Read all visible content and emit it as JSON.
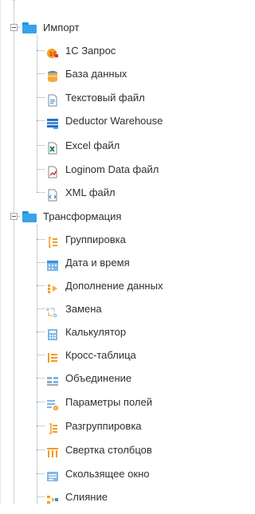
{
  "groups": [
    {
      "label": "Импорт",
      "items": [
        {
          "label": "1C Запрос",
          "icon": "1c-query-icon"
        },
        {
          "label": "База данных",
          "icon": "database-icon"
        },
        {
          "label": "Текстовый файл",
          "icon": "text-file-icon"
        },
        {
          "label": "Deductor Warehouse",
          "icon": "warehouse-icon"
        },
        {
          "label": "Excel файл",
          "icon": "excel-file-icon"
        },
        {
          "label": "Loginom Data файл",
          "icon": "loginom-data-file-icon"
        },
        {
          "label": "XML файл",
          "icon": "xml-file-icon"
        }
      ]
    },
    {
      "label": "Трансформация",
      "items": [
        {
          "label": "Группировка",
          "icon": "grouping-icon"
        },
        {
          "label": "Дата и время",
          "icon": "datetime-icon"
        },
        {
          "label": "Дополнение данных",
          "icon": "data-augment-icon"
        },
        {
          "label": "Замена",
          "icon": "replace-icon"
        },
        {
          "label": "Калькулятор",
          "icon": "calculator-icon"
        },
        {
          "label": "Кросс-таблица",
          "icon": "cross-table-icon"
        },
        {
          "label": "Объединение",
          "icon": "union-icon"
        },
        {
          "label": "Параметры полей",
          "icon": "field-params-icon"
        },
        {
          "label": "Разгруппировка",
          "icon": "ungrouping-icon"
        },
        {
          "label": "Свертка столбцов",
          "icon": "column-fold-icon"
        },
        {
          "label": "Скользящее окно",
          "icon": "sliding-window-icon"
        },
        {
          "label": "Слияние",
          "icon": "merge-icon"
        }
      ]
    }
  ]
}
